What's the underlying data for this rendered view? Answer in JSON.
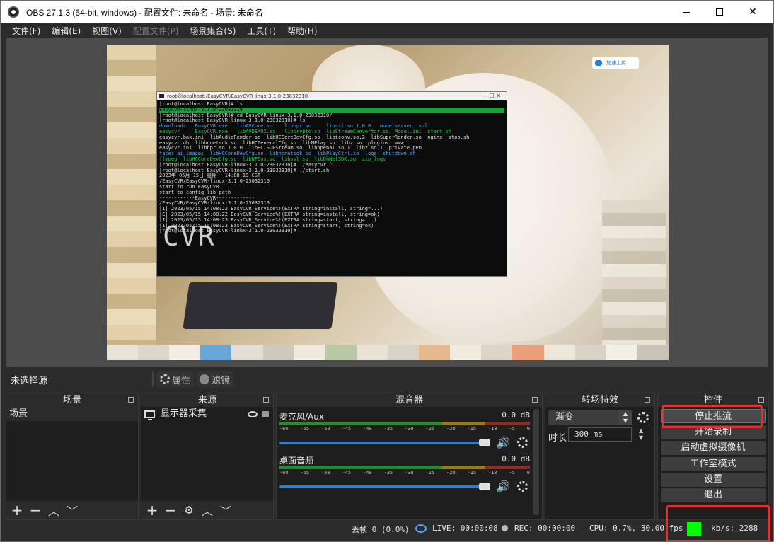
{
  "window": {
    "title": "OBS 27.1.3 (64-bit, windows) - 配置文件: 未命名 - 场景: 未命名"
  },
  "menu": [
    {
      "label": "文件(F)",
      "enabled": true
    },
    {
      "label": "编辑(E)",
      "enabled": true
    },
    {
      "label": "视图(V)",
      "enabled": true
    },
    {
      "label": "配置文件(P)",
      "enabled": false
    },
    {
      "label": "场景集合(S)",
      "enabled": true
    },
    {
      "label": "工具(T)",
      "enabled": true
    },
    {
      "label": "帮助(H)",
      "enabled": true
    }
  ],
  "preview": {
    "badge_text": "加速上传",
    "terminal": {
      "title": "root@localhost:/EasyCVR/EasyCVR-linux-3.1.0-23032310",
      "lines": [
        "[root@localhost EasyCVR]# ls",
        "EasyCVR-linux-3.1.0-23032310",
        "[root@localhost EasyCVR]# cd EasyCVR-linux-3.1.0-23032310/",
        "[root@localhost EasyCVR-linux-3.1.0-23032310]# ls",
        "downloads   EasyCVR.exe   libAVCore.so    libhpr.so     libssl.so.1.0.0   modelserver  sql",
        "easycvr     EasyCVR.exe   libAVDEMUX.so   libcrypto.so  libStreamConvertor.so  Model.ini  start.sh",
        "easycvr.bak.ini  libAudioRender.so  libHCCoreDevCfg.so  libiconv.so.2  libSuperRender.so  nginx  stop.sh",
        "easycvr.db  libhcnetsdk.so  libHCGeneralCfg.so  libMPlay.so  libz.so  plugins  www",
        "easycvr.ini  libhpr.so.1.0.0  libHCISUPStream.so  libopenal.so.1  libz.so.1  private.pem",
        "faces_ai_images  libHCCoreDevCfg.so  libhcnetsdk.so  libPlayCtrl.so  logs  shutdown.sh",
        "ffmpeg  libHCCoreDevCfg.so  libNPQos.so  libssl.so  libDhNetSDK.so  zip_logs",
        "[root@localhost EasyCVR-linux-3.1.0-23032310]# ./easycvr ^C",
        "[root@localhost EasyCVR-linux-3.1.0-23032310]# ./start.sh",
        "2023年 05月 15日 星期一 14:08:19 CST",
        "/EasyCVR/EasyCVR-linux-3.1.0-23032310",
        "start to run EasyCVR",
        "",
        "start to config lib path",
        "------------EasyCVR-------------",
        "/EasyCVR/EasyCVR-linux-3.1.0-23032310",
        "",
        "",
        "",
        "[I] 2023/05/15 14:08:22 EasyCVR_Service%!(EXTRA string=install, string=...)",
        "[E] 2023/05/15 14:08:22 EasyCVR_Service%!(EXTRA string=install, string=ok)",
        "[I] 2023/05/15 14:08:23 EasyCVR_Service%!(EXTRA string=start, string=...)",
        "[I] 2023/05/15 14:08:23 EasyCVR_Service%!(EXTRA string=start, string=ok)",
        "[root@localhost EasyCVR-linux-3.1.0-23032310]#"
      ],
      "ascii_logo": "CVR"
    }
  },
  "source_bar": {
    "no_source": "未选择源",
    "properties": "属性",
    "filters": "滤镜"
  },
  "docks": {
    "scenes": {
      "title": "场景",
      "items": [
        "场景"
      ]
    },
    "sources": {
      "title": "来源",
      "items": [
        {
          "label": "显示器采集",
          "icon": "monitor-icon"
        }
      ]
    },
    "mixer": {
      "title": "混音器",
      "ticks": [
        "-60",
        "-55",
        "-50",
        "-45",
        "-40",
        "-35",
        "-30",
        "-25",
        "-20",
        "-15",
        "-10",
        "-5",
        "0"
      ],
      "channels": [
        {
          "name": "麦克风/Aux",
          "db": "0.0 dB",
          "volume_fraction": 0.96
        },
        {
          "name": "桌面音频",
          "db": "0.0 dB",
          "volume_fraction": 0.96
        }
      ]
    },
    "transitions": {
      "title": "转场特效",
      "selected": "渐变",
      "duration_label": "时长",
      "duration_value": "300 ms"
    },
    "controls": {
      "title": "控件",
      "buttons": [
        "停止推流",
        "开始录制",
        "启动虚拟摄像机",
        "工作室模式",
        "设置",
        "退出"
      ]
    }
  },
  "status": {
    "dropped": "丢帧 0 (0.0%)",
    "live": "LIVE: 00:00:08",
    "rec": "REC: 00:00:00",
    "cpu": "CPU: 0.7%, 30.00 fps",
    "bitrate": "kb/s: 2288",
    "indicator_color": "#00ff00"
  }
}
